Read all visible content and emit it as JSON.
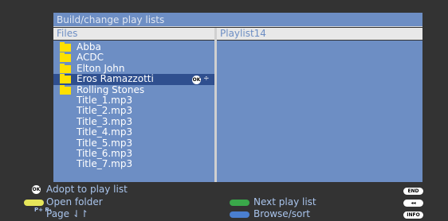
{
  "dialog": {
    "title": "Build/change play lists",
    "files_header": "Files",
    "playlist_header": "Playlist14"
  },
  "files": {
    "items": [
      {
        "label": "Abba",
        "type": "folder",
        "selected": false
      },
      {
        "label": "ACDC",
        "type": "folder",
        "selected": false
      },
      {
        "label": "Elton John",
        "type": "folder",
        "selected": false
      },
      {
        "label": "Eros Ramazzotti",
        "type": "folder",
        "selected": true
      },
      {
        "label": "Rolling Stones",
        "type": "folder",
        "selected": false
      },
      {
        "label": "Title_1.mp3",
        "type": "file",
        "selected": false
      },
      {
        "label": "Title_2.mp3",
        "type": "file",
        "selected": false
      },
      {
        "label": "Title_3.mp3",
        "type": "file",
        "selected": false
      },
      {
        "label": "Title_4.mp3",
        "type": "file",
        "selected": false
      },
      {
        "label": "Title_5.mp3",
        "type": "file",
        "selected": false
      },
      {
        "label": "Title_6.mp3",
        "type": "file",
        "selected": false
      },
      {
        "label": "Title_7.mp3",
        "type": "file",
        "selected": false
      }
    ],
    "selected_key": "OK",
    "selected_arrows": "÷"
  },
  "help": {
    "adopt": "Adopt to play list",
    "open_folder": "Open folder",
    "page": "Page ⇃↾",
    "next_playlist": "Next play list",
    "browse_sort": "Browse/sort",
    "ok_key": "OK",
    "page_key": "P+ P-",
    "end_key": "END",
    "back_key": "◂◂",
    "info_key": "INFO"
  },
  "colors": {
    "background": "#333333",
    "pane": "#6d8ec4",
    "selected": "#2f4f8f",
    "folder": "#ffe000",
    "yellow_key": "#e6e65a",
    "green_key": "#3aa84a",
    "blue_key": "#4a7fd0"
  }
}
